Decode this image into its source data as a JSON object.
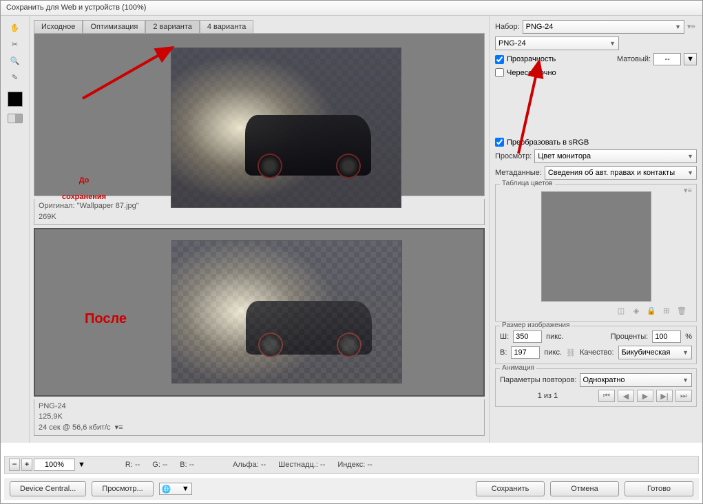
{
  "window": {
    "title": "Сохранить для Web и устройств (100%)"
  },
  "tabs": [
    "Исходное",
    "Оптимизация",
    "2 варианта",
    "4 варианта"
  ],
  "active_tab": 2,
  "annotations": {
    "before_line1": "До",
    "before_line2": "сохранения",
    "after": "После"
  },
  "info_top": {
    "line1": "Оригинал: \"Wallpaper 87.jpg\"",
    "line2": "269K"
  },
  "info_bot": {
    "line1": "PNG-24",
    "line2": "125,9K",
    "line3": "24 сек @ 56,6 кбит/с"
  },
  "zoom": {
    "value": "100%"
  },
  "stats": {
    "r": "R: --",
    "g": "G: --",
    "b": "B: --",
    "alpha": "Альфа: --",
    "hex": "Шестнадц.: --",
    "index": "Индекс: --"
  },
  "right": {
    "preset_label": "Набор:",
    "preset_value": "PNG-24",
    "format_value": "PNG-24",
    "transparency": "Прозрачность",
    "transparency_checked": true,
    "interlace": "Чересстрочно",
    "interlace_checked": false,
    "matte_label": "Матовый:",
    "matte_value": "--",
    "srgb": "Преобразовать в sRGB",
    "srgb_checked": true,
    "preview_label": "Просмотр:",
    "preview_value": "Цвет монитора",
    "meta_label": "Метаданные:",
    "meta_value": "Сведения об авт. правах и контакты",
    "color_table": "Таблица цветов",
    "image_size": "Размер изображения",
    "w_label": "Ш:",
    "w_value": "350",
    "w_unit": "пикс.",
    "h_label": "В:",
    "h_value": "197",
    "h_unit": "пикс.",
    "percent_label": "Проценты:",
    "percent_value": "100",
    "percent_unit": "%",
    "quality_label": "Качество:",
    "quality_value": "Бикубическая",
    "animation_title": "Анимация",
    "loop_label": "Параметры повторов:",
    "loop_value": "Однократно",
    "frame_text": "1 из 1"
  },
  "footer": {
    "device_central": "Device Central...",
    "preview": "Просмотр...",
    "save": "Сохранить",
    "cancel": "Отмена",
    "done": "Готово"
  }
}
